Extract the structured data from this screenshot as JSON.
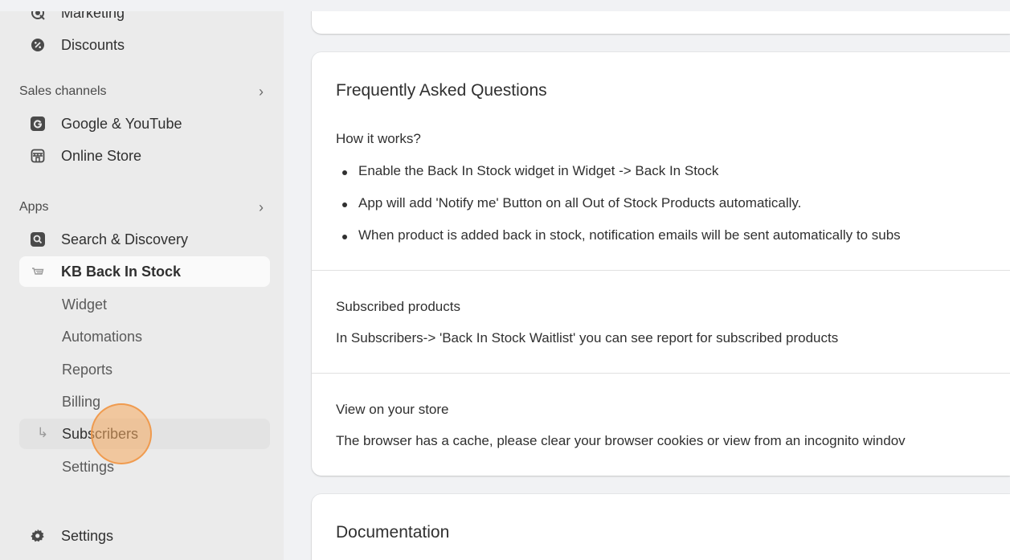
{
  "sidebar": {
    "top_items": [
      {
        "label": "Marketing",
        "icon": "target-icon"
      },
      {
        "label": "Discounts",
        "icon": "discount-icon"
      }
    ],
    "sales_channels": {
      "heading": "Sales channels",
      "items": [
        {
          "label": "Google & YouTube",
          "icon": "google-icon"
        },
        {
          "label": "Online Store",
          "icon": "store-icon"
        }
      ]
    },
    "apps": {
      "heading": "Apps",
      "items": [
        {
          "label": "Search & Discovery",
          "icon": "search-icon"
        },
        {
          "label": "KB Back In Stock",
          "icon": "cart-icon"
        }
      ],
      "subitems": [
        "Widget",
        "Automations",
        "Reports",
        "Billing",
        "Subscribers",
        "Settings"
      ]
    },
    "bottom": {
      "label": "Settings",
      "icon": "gear-icon"
    }
  },
  "faq": {
    "title": "Frequently Asked Questions",
    "how_heading": "How it works?",
    "bullets": [
      "Enable the Back In Stock widget in Widget -> Back In Stock",
      "App will add 'Notify me' Button on all Out of Stock Products automatically.",
      "When product is added back in stock, notification emails will be sent automatically to subs"
    ],
    "subscribed": {
      "heading": "Subscribed products",
      "text": "In Subscribers-> 'Back In Stock Waitlist' you can see report for subscribed products"
    },
    "view_store": {
      "heading": "View on your store",
      "text": "The browser has a cache, please clear your browser cookies or view from an incognito windov"
    }
  },
  "docs": {
    "title": "Documentation"
  },
  "colors": {
    "sidebar_bg": "#ebebeb",
    "page_bg": "#f1f2f4",
    "card_bg": "#ffffff",
    "click_marker": "#f6aa5f"
  }
}
